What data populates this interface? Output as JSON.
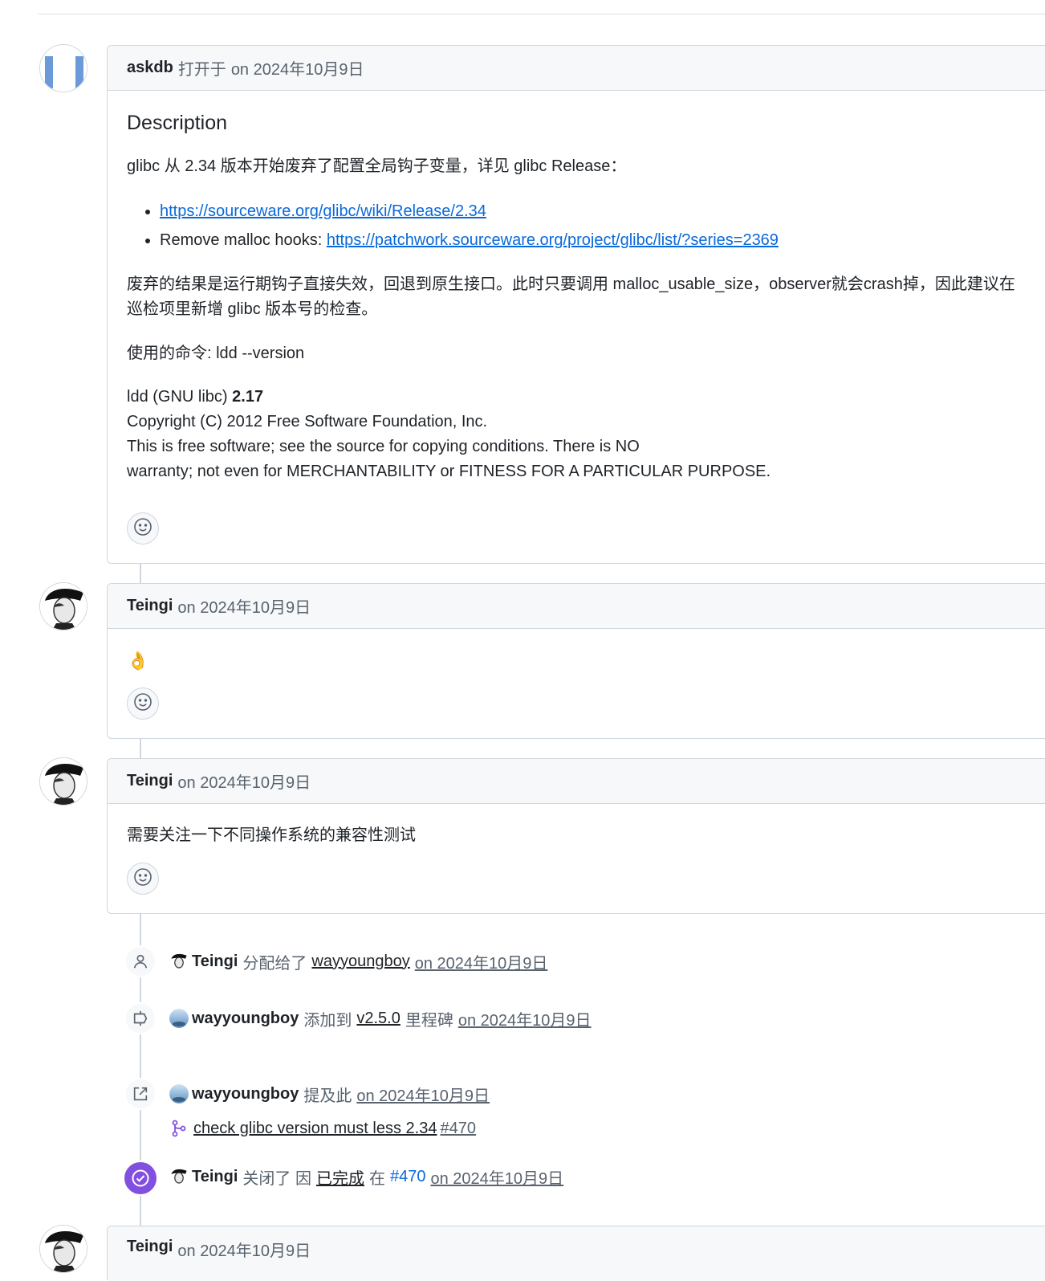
{
  "issue_body": {
    "author": "askdb",
    "action": "打开于",
    "date": "on 2024年10月9日",
    "heading": "Description",
    "para1": "glibc 从 2.34 版本开始废弃了配置全局钩子变量，详见 glibc Release：",
    "bullets": [
      {
        "prefix": "",
        "link": "https://sourceware.org/glibc/wiki/Release/2.34"
      },
      {
        "prefix": "Remove malloc hooks: ",
        "link": "https://patchwork.sourceware.org/project/glibc/list/?series=2369"
      }
    ],
    "para2_line1": "废弃的结果是运行期钩子直接失效，回退到原生接口。此时只要调用 malloc_usable_size，observer就会crash掉，因此建议在",
    "para2_line2": "巡检项里新增 glibc 版本号的检查。",
    "para3": "使用的命令: ldd --version",
    "output_prefix": "ldd (GNU libc) ",
    "output_version": "2.17",
    "output_lines": [
      "Copyright (C) 2012 Free Software Foundation, Inc.",
      "This is free software; see the source for copying conditions. There is NO",
      "warranty; not even for MERCHANTABILITY or FITNESS FOR A PARTICULAR PURPOSE."
    ]
  },
  "comments": [
    {
      "author": "Teingi",
      "date": "on 2024年10月9日",
      "body": "👌"
    },
    {
      "author": "Teingi",
      "date": "on 2024年10月9日",
      "body": "需要关注一下不同操作系统的兼容性测试"
    },
    {
      "author": "Teingi",
      "date": "on 2024年10月9日",
      "body": ""
    }
  ],
  "events": {
    "assigned": {
      "actor": "Teingi",
      "action": "分配给了",
      "target": "wayyoungboy",
      "date": "on 2024年10月9日"
    },
    "milestone": {
      "actor": "wayyoungboy",
      "action": "添加到",
      "target": "v2.5.0",
      "suffix": "里程碑",
      "date": "on 2024年10月9日"
    },
    "mentioned": {
      "actor": "wayyoungboy",
      "action": "提及此",
      "date": "on 2024年10月9日",
      "pr_title": "check glibc version must less 2.34",
      "pr_number": "#470"
    },
    "closed": {
      "actor": "Teingi",
      "action": "关闭了 因",
      "reason": "已完成",
      "in": "在",
      "pr_number": "#470",
      "date": "on 2024年10月9日"
    }
  },
  "colors": {
    "link": "#0969da",
    "muted": "#59636e",
    "border": "#d0d7de",
    "header_bg": "#f6f8fa",
    "closed_purple": "#8250df"
  }
}
